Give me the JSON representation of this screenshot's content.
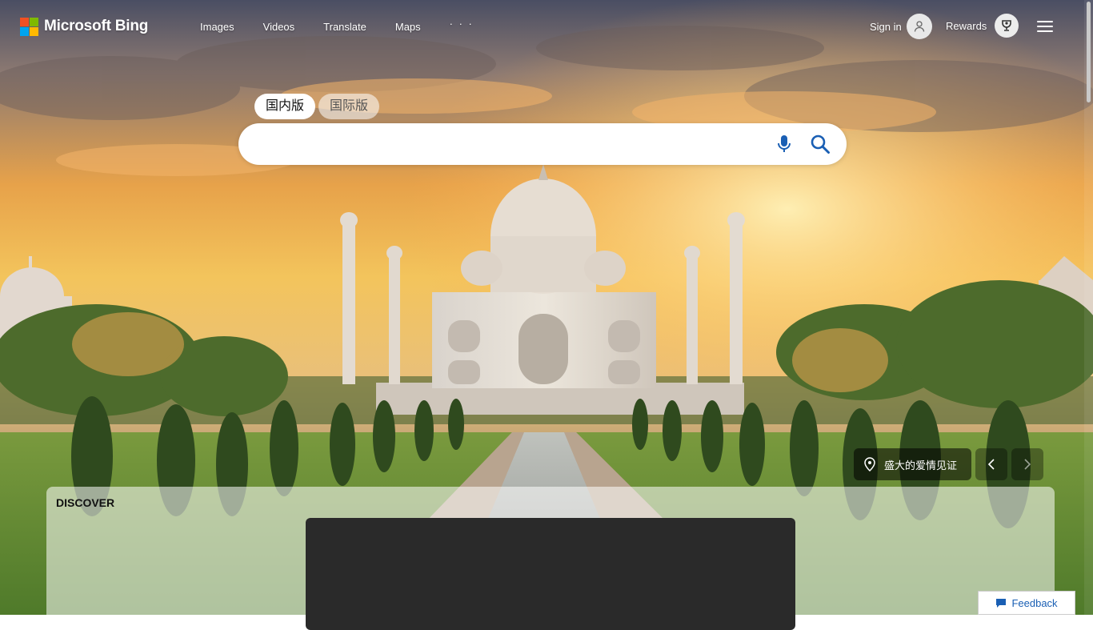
{
  "brand": {
    "name": "Microsoft Bing",
    "colors": {
      "red": "#f25022",
      "green": "#7fba00",
      "blue": "#00a4ef",
      "yellow": "#ffb900"
    }
  },
  "nav": {
    "items": [
      {
        "label": "Images"
      },
      {
        "label": "Videos"
      },
      {
        "label": "Translate"
      },
      {
        "label": "Maps"
      }
    ],
    "more": "· · ·"
  },
  "account": {
    "sign_in": "Sign in",
    "rewards": "Rewards"
  },
  "search": {
    "tabs": [
      {
        "label": "国内版",
        "active": true
      },
      {
        "label": "国际版",
        "active": false
      }
    ],
    "value": "",
    "placeholder": "",
    "mic_icon": "microphone-icon",
    "search_icon": "search-icon"
  },
  "image_info": {
    "caption": "盛大的爱情见证",
    "pin_icon": "location-pin-icon"
  },
  "discover": {
    "title": "DISCOVER"
  },
  "feedback": {
    "label": "Feedback"
  }
}
